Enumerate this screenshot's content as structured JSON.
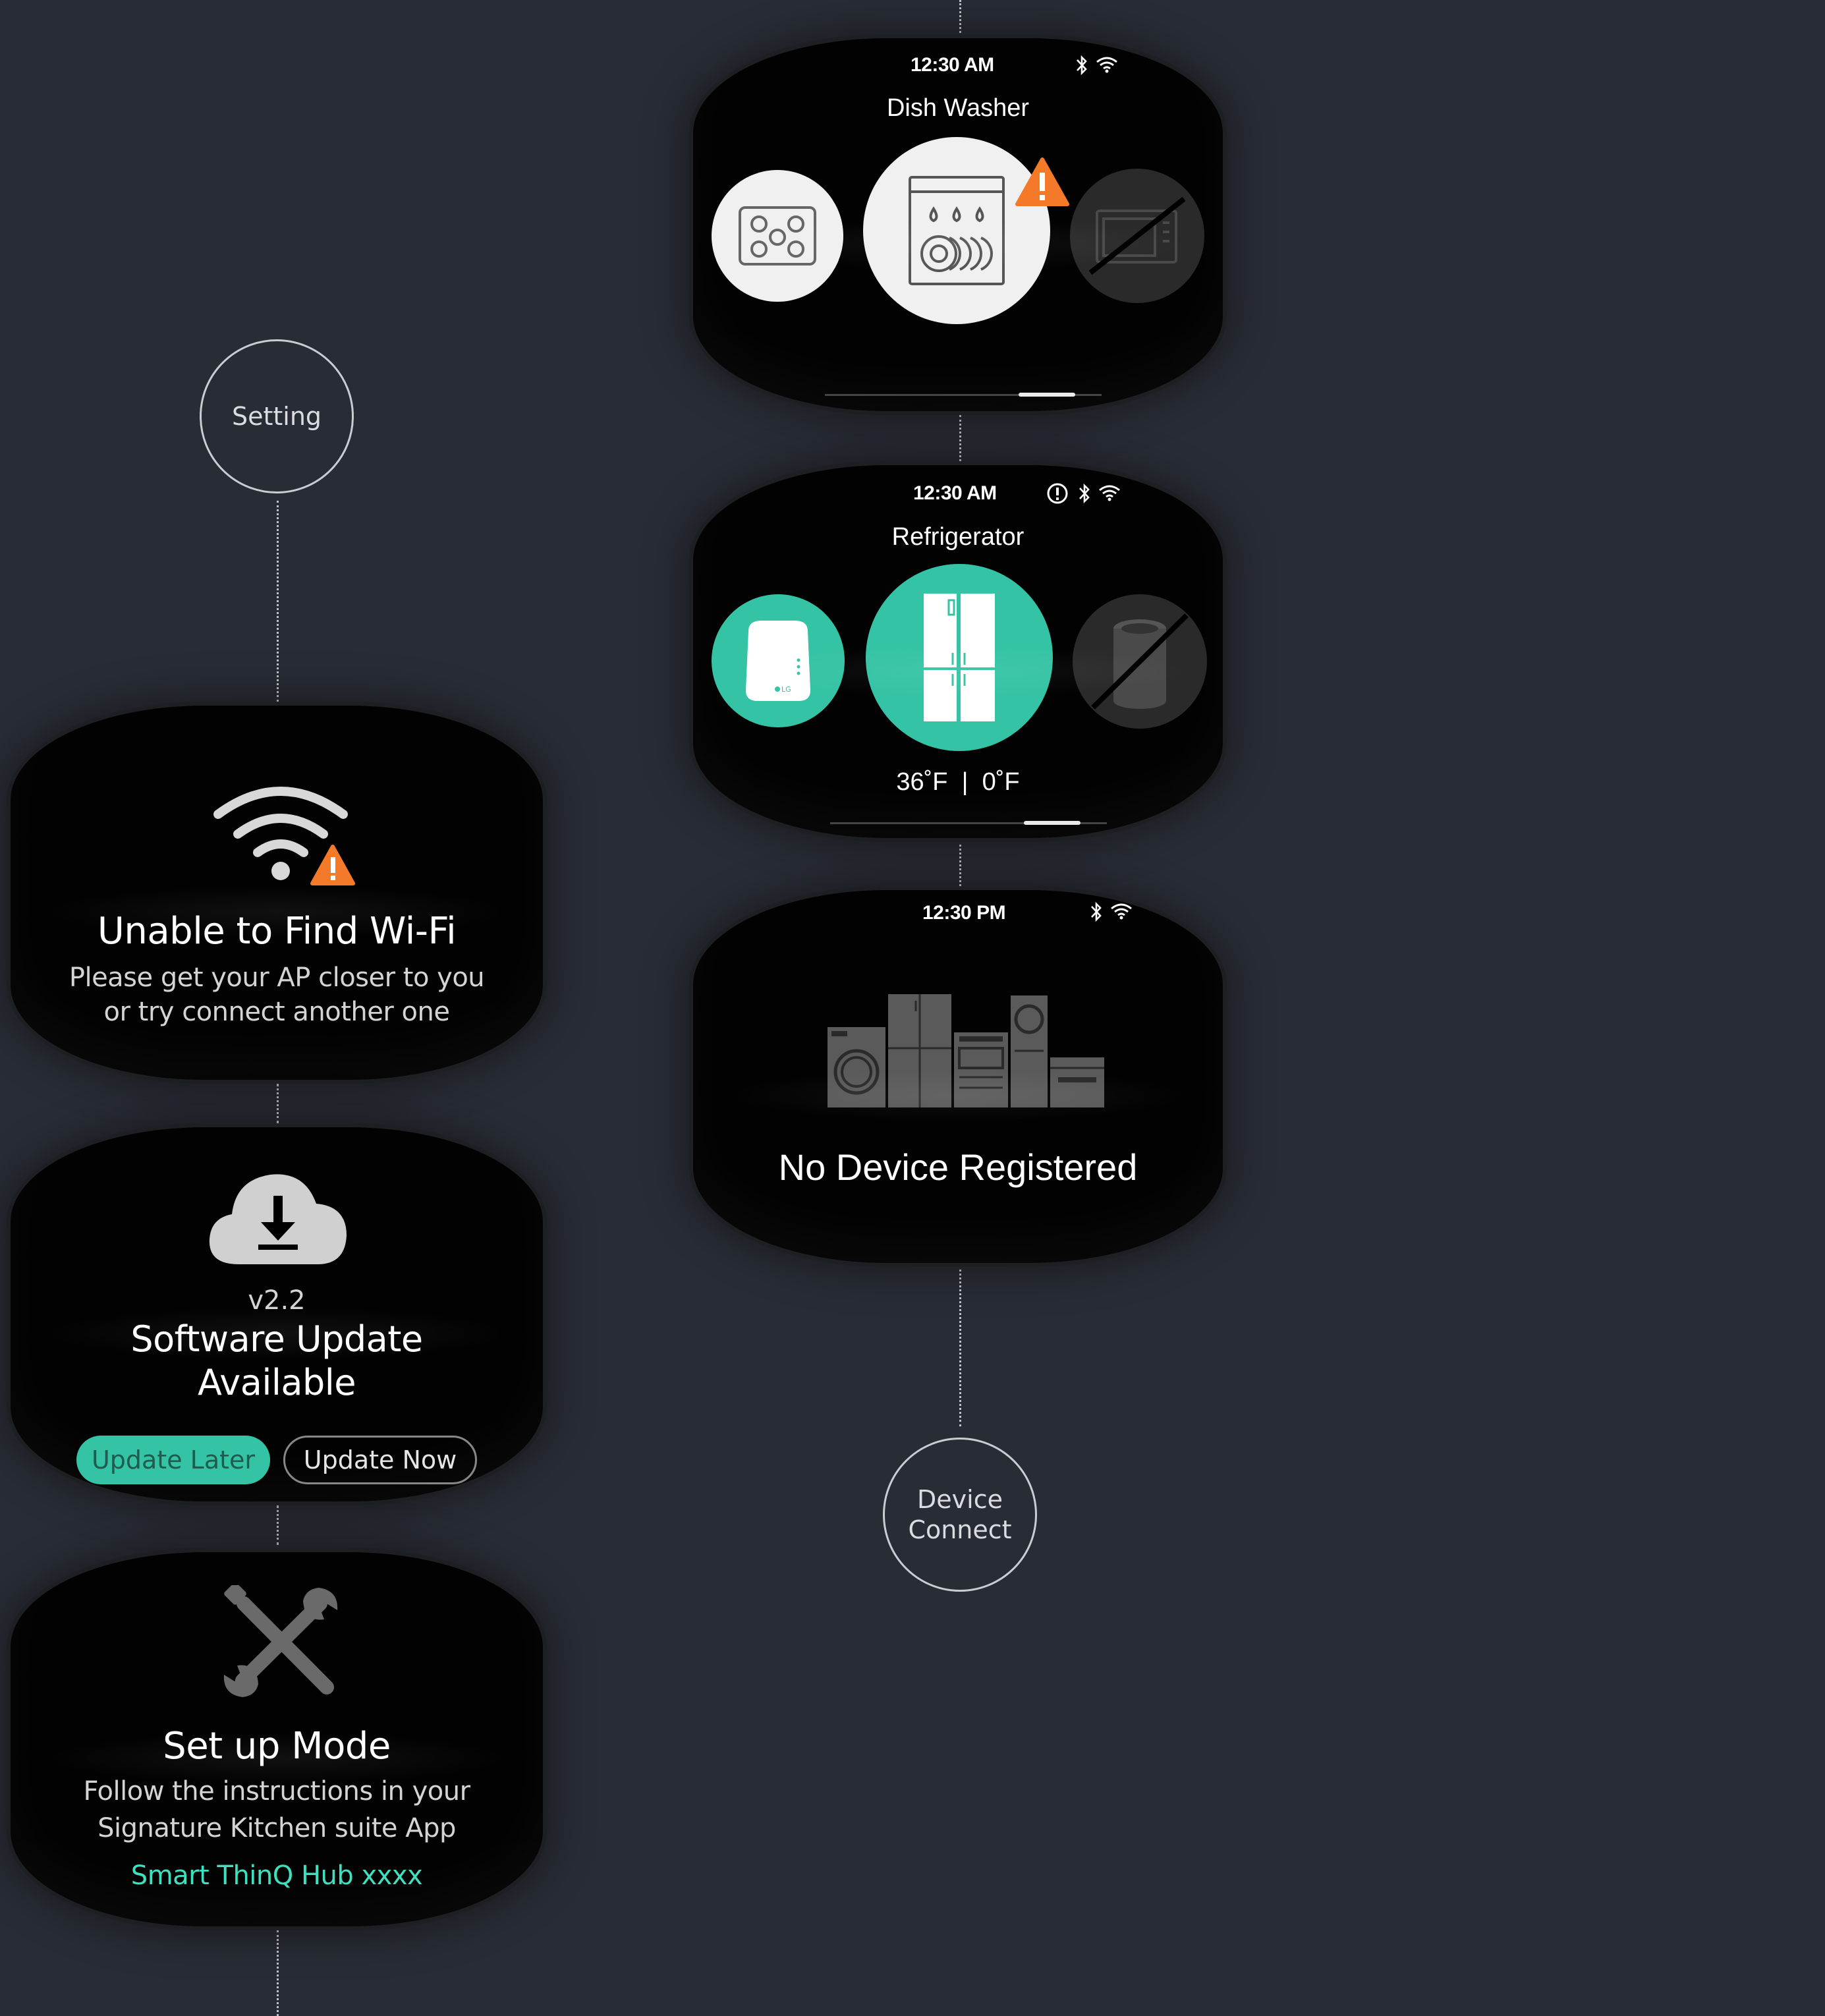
{
  "nodes": {
    "setting": "Setting",
    "device_connect": "Device\nConnect"
  },
  "dishwasher": {
    "time": "12:30 AM",
    "title": "Dish Washer",
    "icons": [
      "bluetooth-icon",
      "wifi-icon",
      "cooktop-icon",
      "dishwasher-icon",
      "warning-icon",
      "microwave-disabled-icon"
    ],
    "pager": {
      "count": 3,
      "active": 2
    }
  },
  "refrigerator": {
    "time": "12:30 AM",
    "title": "Refrigerator",
    "temperature": "36˚F  |  0˚F",
    "icons": [
      "alert-icon",
      "bluetooth-icon",
      "wifi-icon",
      "hub-icon",
      "refrigerator-icon",
      "air-purifier-disabled-icon"
    ],
    "pager": {
      "count": 3,
      "active": 2
    }
  },
  "no_device": {
    "time": "12:30 PM",
    "message": "No Device Registered",
    "icons": [
      "bluetooth-icon",
      "wifi-icon",
      "appliances-icon"
    ]
  },
  "wifi_error": {
    "title": "Unable to Find Wi-Fi",
    "message_line1": "Please get your AP closer to you",
    "message_line2": "or try connect another one",
    "icons": [
      "wifi-icon",
      "warning-icon"
    ]
  },
  "update": {
    "version": "v2.2",
    "title_line1": "Software Update",
    "title_line2": "Available",
    "later_label": "Update Later",
    "now_label": "Update Now",
    "icons": [
      "cloud-download-icon"
    ]
  },
  "setup": {
    "title": "Set up Mode",
    "message_line1": "Follow the instructions in your",
    "message_line2": "Signature Kitchen suite App",
    "hub_name": "Smart ThinQ Hub xxxx",
    "icons": [
      "tools-icon"
    ]
  },
  "colors": {
    "background": "#282c34",
    "accent_teal": "#34c3a4",
    "warning_orange": "#f47a2a",
    "hub_text_teal": "#3fe0c0"
  }
}
